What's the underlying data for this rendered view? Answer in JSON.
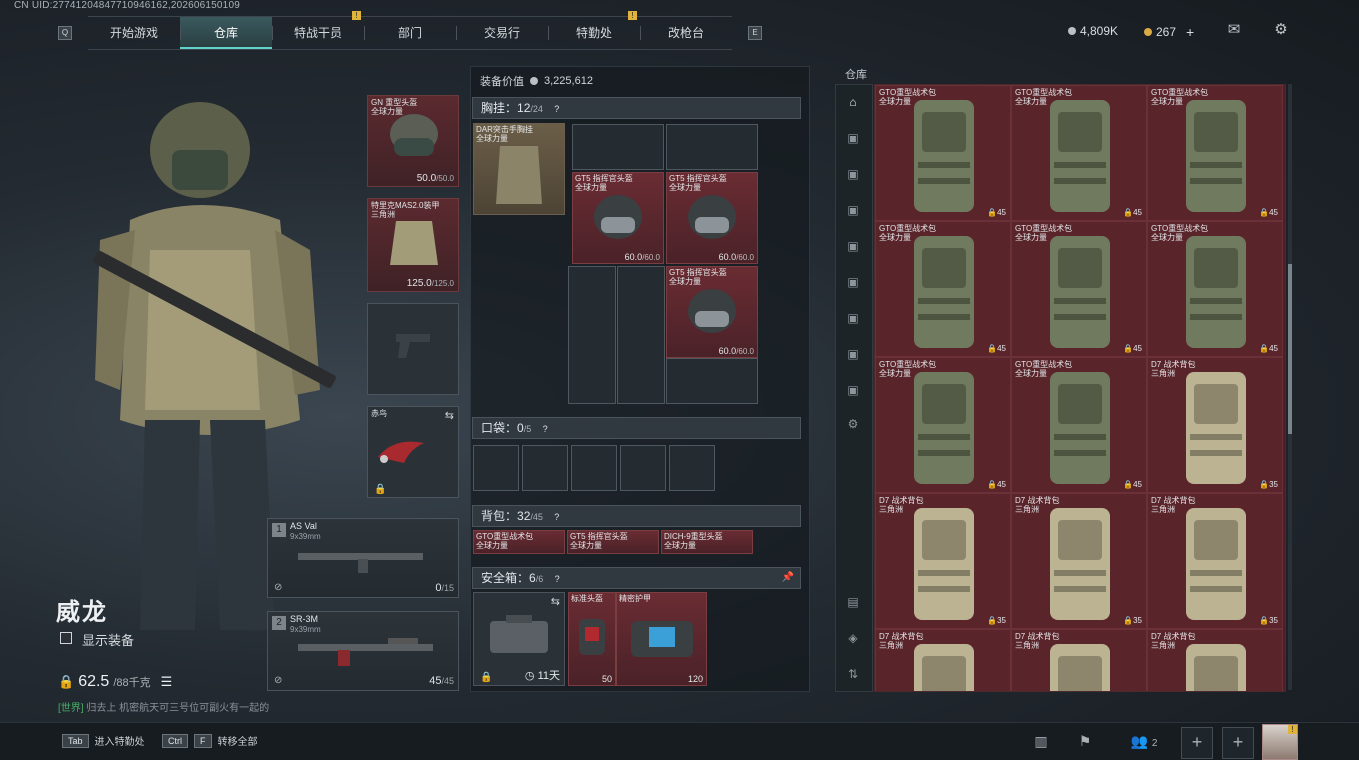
{
  "uid": "CN UID:27741204847710946162,202606150109",
  "nav": {
    "left_key": "Q",
    "right_key": "E",
    "tabs": [
      {
        "label": "开始游戏"
      },
      {
        "label": "仓库",
        "active": true
      },
      {
        "label": "特战干员",
        "badge": "!"
      },
      {
        "label": "部门"
      },
      {
        "label": "交易行"
      },
      {
        "label": "特勤处",
        "badge": "!"
      },
      {
        "label": "改枪台"
      }
    ]
  },
  "currency": {
    "silver": "4,809K",
    "gold": "267",
    "add": "+"
  },
  "character": {
    "name": "威龙",
    "show_equipment": "显示装备",
    "weight": "62.5",
    "weight_max": "/88千克"
  },
  "chat": {
    "channel": "[世界]",
    "message": "归去上 机密航天可三号位可副火有一起的"
  },
  "equip_slots": {
    "helmet": {
      "name": "GN 重型头盔\n全球力量",
      "value": "50.0",
      "max": "/50.0"
    },
    "armor": {
      "name": "特里克MAS2.0装甲\n三角洲",
      "value": "125.0",
      "max": "/125.0"
    },
    "melee": {
      "name": "赤鸟"
    }
  },
  "weapons": [
    {
      "num": "1",
      "name": "AS Val",
      "caliber": "9x39mm",
      "ammo": "0",
      "ammo_max": "/15"
    },
    {
      "num": "2",
      "name": "SR-3M",
      "caliber": "9x39mm",
      "ammo": "45",
      "ammo_max": "/45"
    }
  ],
  "loadout": {
    "value_label": "装备价值",
    "value": "3,225,612",
    "chest": {
      "label": "胸挂：",
      "used": "12",
      "cap": "/24",
      "item": "DAR突击手胸挂\n全球力量"
    },
    "helmets": [
      {
        "name": "GT5 指挥官头盔\n全球力量",
        "value": "60.0",
        "max": "/60.0"
      },
      {
        "name": "GT5 指挥官头盔\n全球力量",
        "value": "60.0",
        "max": "/60.0"
      },
      {
        "name": "GT5 指挥官头盔\n全球力量",
        "value": "60.0",
        "max": "/60.0"
      }
    ],
    "pocket": {
      "label": "口袋：",
      "used": "0",
      "cap": "/5"
    },
    "backpack": {
      "label": "背包：",
      "used": "32",
      "cap": "/45",
      "items": [
        "GTO重型战术包\n全球力量",
        "GT5 指挥官头盔\n全球力量",
        "DICH-9重型头盔\n全球力量"
      ]
    },
    "safebox": {
      "label": "安全箱：",
      "used": "6",
      "cap": "/6",
      "days": "11天",
      "items": [
        {
          "name": "标准头盔",
          "value": "50"
        },
        {
          "name": "精密护甲",
          "value": "120"
        }
      ]
    }
  },
  "warehouse": {
    "label": "仓库",
    "items": [
      {
        "name": "GTO重型战术包\n全球力量",
        "value": "45"
      },
      {
        "name": "GTO重型战术包\n全球力量",
        "value": "45"
      },
      {
        "name": "GTO重型战术包\n全球力量",
        "value": "45"
      },
      {
        "name": "GTO重型战术包\n全球力量",
        "value": "45"
      },
      {
        "name": "GTO重型战术包\n全球力量",
        "value": "45"
      },
      {
        "name": "GTO重型战术包\n全球力量",
        "value": "45"
      },
      {
        "name": "GTO重型战术包\n全球力量",
        "value": "45"
      },
      {
        "name": "GTO重型战术包\n全球力量",
        "value": "45"
      },
      {
        "name": "D7 战术背包\n三角洲",
        "value": "35"
      },
      {
        "name": "D7 战术背包\n三角洲",
        "value": "35"
      },
      {
        "name": "D7 战术背包\n三角洲",
        "value": "35"
      },
      {
        "name": "D7 战术背包\n三角洲",
        "value": "35"
      },
      {
        "name": "D7 战术背包\n三角洲",
        "value": ""
      },
      {
        "name": "D7 战术背包\n三角洲",
        "value": ""
      },
      {
        "name": "D7 战术背包\n三角洲",
        "value": ""
      }
    ],
    "colors": {
      "olive": "#6f7a5e",
      "tan": "#bcb392"
    }
  },
  "bottom": {
    "hint1": {
      "key": "Tab",
      "label": "进入特勤处"
    },
    "hint2": {
      "key1": "Ctrl",
      "key2": "F",
      "label": "转移全部"
    },
    "friends": "2"
  }
}
